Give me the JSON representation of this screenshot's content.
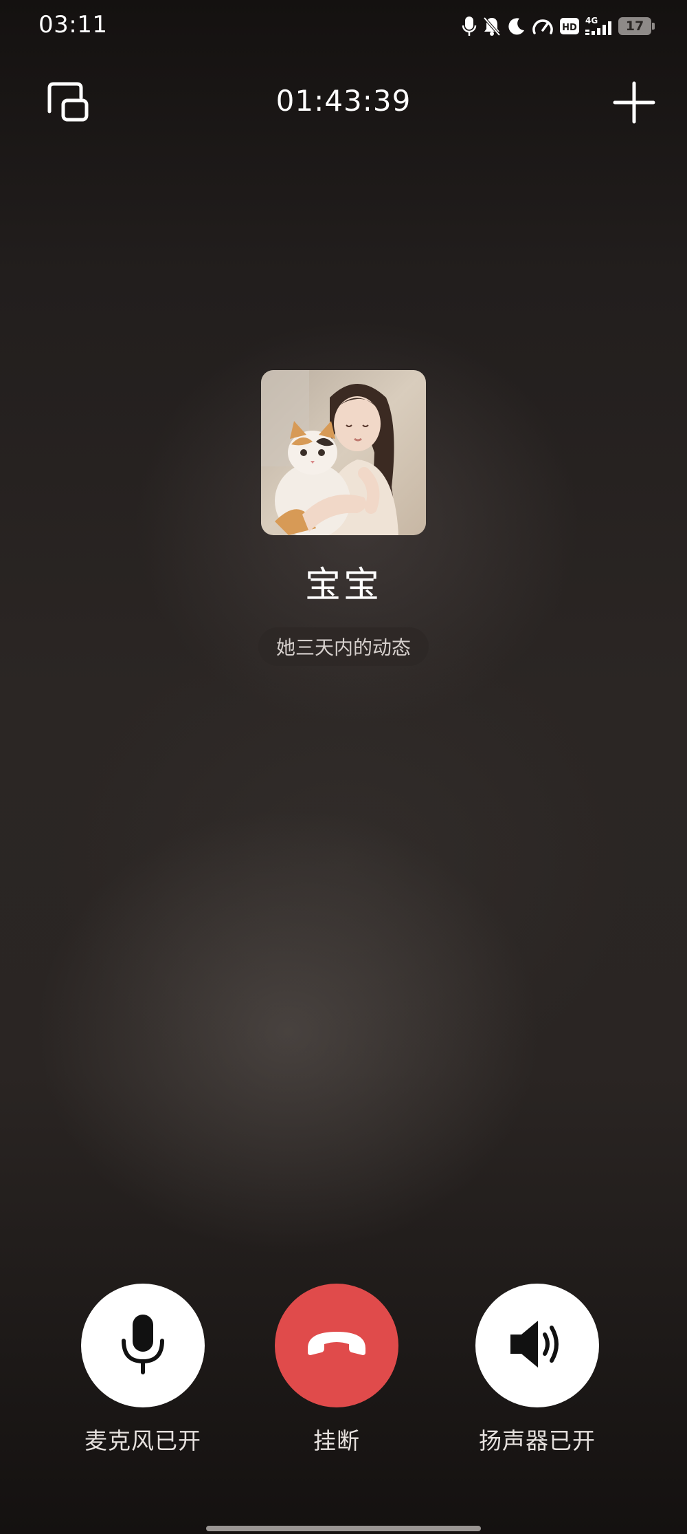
{
  "status_bar": {
    "time": "03:11",
    "icons": [
      "microphone-in-use-icon",
      "bell-muted-icon",
      "moon-icon",
      "speed-gauge-icon",
      "hd-icon",
      "4g-signal-icon"
    ],
    "hd_label": "HD",
    "network_label": "4G",
    "battery_level": "17"
  },
  "top_bar": {
    "minimize_icon": "floating-window-icon",
    "timer": "01:43:39",
    "add_icon": "plus-icon"
  },
  "contact": {
    "name": "宝宝",
    "moments_label": "她三天内的动态"
  },
  "controls": {
    "mic": {
      "label": "麦克风已开",
      "icon": "microphone-icon"
    },
    "hangup": {
      "label": "挂断",
      "icon": "hang-up-icon",
      "color": "#e04b4b"
    },
    "speaker": {
      "label": "扬声器已开",
      "icon": "speaker-icon"
    }
  }
}
